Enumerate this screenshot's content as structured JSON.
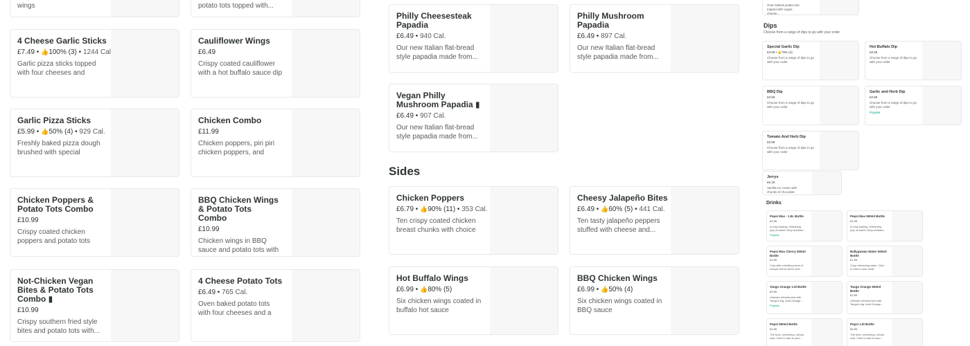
{
  "col1": [
    {
      "name": "",
      "price": "",
      "desc": "wings"
    },
    {
      "name": "4 Cheese Garlic Sticks",
      "price": "£7.49",
      "rating": "100% (3)",
      "cal": "1244 Cal.",
      "desc": "Garlic pizza sticks topped with four cheeses and Itali..."
    },
    {
      "name": "Garlic Pizza Sticks",
      "price": "£5.99",
      "rating": "50% (4)",
      "cal": "929 Cal.",
      "desc": "Freshly baked pizza dough brushed with special garlic..."
    },
    {
      "name": "Chicken Poppers & Potato Tots Combo",
      "price": "£10.99",
      "desc": "Crispy coated chicken poppers and potato tots wit..."
    },
    {
      "name": "Not-Chicken Vegan Bites & Potato Tots Combo ▮",
      "price": "£10.99",
      "desc": "Crispy southern fried style bites and potato tots with..."
    }
  ],
  "col2": [
    {
      "name": "",
      "price": "",
      "desc": "potato tots topped with..."
    },
    {
      "name": "Cauliflower Wings",
      "price": "£6.49",
      "desc": "Crispy coated cauliflower with a hot buffalo sauce dip"
    },
    {
      "name": "Chicken Combo",
      "price": "£11.99",
      "desc": "Chicken poppers, piri piri chicken poppers, and BBQ..."
    },
    {
      "name": "BBQ Chicken Wings & Potato Tots Combo",
      "price": "£10.99",
      "desc": "Chicken wings in BBQ sauce and potato tots with garlic ..."
    },
    {
      "name": "4 Cheese Potato Tots",
      "price": "£6.49",
      "cal": "765 Cal.",
      "desc": "Oven baked potato tots with four cheeses and a choice ..."
    }
  ],
  "col3": [
    {
      "name": "Philly Cheesesteak Papadia",
      "price": "£6.49",
      "cal": "940 Cal.",
      "desc": "Our new Italian flat-bread style papadia made from..."
    },
    {
      "name": "Vegan Philly Mushroom Papadia ▮",
      "price": "£6.49",
      "cal": "907 Cal.",
      "desc": "Our new Italian flat-bread style papadia made from..."
    }
  ],
  "col4": [
    {
      "name": "Philly Mushroom Papadia",
      "price": "£6.49",
      "cal": "897 Cal.",
      "desc": "Our new Italian flat-bread style papadia made from..."
    }
  ],
  "sides_title": "Sides",
  "sides": [
    {
      "name": "Chicken Poppers",
      "price": "£6.79",
      "rating": "90% (11)",
      "cal": "353 Cal.",
      "desc": "Ten crispy coated chicken breast chunks with choice ..."
    },
    {
      "name": "Cheesy Jalapeño Bites",
      "price": "£6.49",
      "rating": "60% (5)",
      "cal": "441 Cal.",
      "desc": "Ten tasty jalapeño peppers stuffed with cheese and..."
    },
    {
      "name": "Hot Buffalo Wings",
      "price": "£6.99",
      "rating": "80% (5)",
      "desc": "Six chicken wings coated in buffalo hot sauce"
    },
    {
      "name": "BBQ Chicken Wings",
      "price": "£6.99",
      "rating": "50% (4)",
      "desc": "Six chicken wings coated in BBQ sauce"
    }
  ],
  "mini": {
    "top_desc": "Oven baked potato tots topped with vegan cheese...",
    "dips_title": "Dips",
    "dips_sub": "Choose from a range of dips to go with your order",
    "dips": [
      {
        "name": "Special Garlic Dip",
        "price": "£0.59",
        "rating": "75% (4)",
        "desc": "Choose from a range of dips to go with your order"
      },
      {
        "name": "Hot Buffalo Dip",
        "price": "£0.59",
        "desc": "Choose from a range of dips to go with your order"
      },
      {
        "name": "BBQ  Dip",
        "price": "£0.59",
        "desc": "Choose from a range of dips to go with your order"
      },
      {
        "name": "Garlic and Herb Dip",
        "price": "£0.59",
        "desc": "Choose from a range of dips to go with your order",
        "popular": "Popular"
      },
      {
        "name": "Tomato And Herb Dip",
        "price": "£0.59",
        "desc": "Choose from a range of dips to go with your order"
      }
    ],
    "jerrys": {
      "name": "Jerrys",
      "price": "£6.19",
      "desc": "Vanilla ice cream with chunks of chocolate chip..."
    },
    "drinks_title": "Drinks",
    "drinks": [
      {
        "name": "Pepsi Max - 1.5L Bottle",
        "price": "£2.99",
        "desc": "A crisp tasting, refreshing pop of sweet, fizzy bubbles...",
        "popular": "Popular"
      },
      {
        "name": "Pepsi Max 500ml Bottle",
        "price": "£1.99",
        "desc": "A crisp tasting, refreshing pop of sweet, fizzy bubbles..."
      },
      {
        "name": "Pepsi Max Cherry 500ml Bottle",
        "price": "£1.99",
        "desc": "Cola with a thrilling burst of unique cherry flavor and..."
      },
      {
        "name": "Ballygowan Water 500ml Bottle",
        "price": "£1.99",
        "desc": "Crisp refreshing taste. Click to add to your meal."
      },
      {
        "name": "Tango Orange 1.5l Bottle",
        "price": "£2.99",
        "desc": "Unleash refreshment with Tango's big, bold Orange...",
        "popular": "Popular"
      },
      {
        "name": "Tango Orange 500ml Bottle",
        "price": "£1.99",
        "desc": "Unleash refreshment with Tango's big, bold Orange..."
      },
      {
        "name": "Pepsi 500ml Bottle",
        "price": "£1.99",
        "desc": "The bold, refreshing, robust cola. Click to add to your..."
      },
      {
        "name": "Pepsi 1.5l Bottle",
        "price": "£2.99",
        "desc": "The bold, refreshing, robust cola. Click to add to your..."
      }
    ]
  }
}
